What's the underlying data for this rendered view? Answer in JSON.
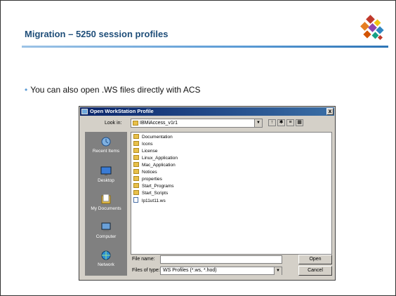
{
  "slide": {
    "title": "Migration – 5250 session profiles",
    "bullet": "You can also open .WS files directly with ACS"
  },
  "dialog": {
    "title": "Open WorkStation Profile",
    "close_label": "x",
    "look_in_label": "Look in:",
    "look_in_value": "IBMiAccess_v1r1",
    "places": [
      {
        "label": "Recent Items",
        "icon": "recent-items-icon"
      },
      {
        "label": "Desktop",
        "icon": "desktop-icon"
      },
      {
        "label": "My Documents",
        "icon": "my-documents-icon"
      },
      {
        "label": "Computer",
        "icon": "computer-icon"
      },
      {
        "label": "Network",
        "icon": "network-icon"
      }
    ],
    "files": [
      {
        "name": "Documentation",
        "type": "folder"
      },
      {
        "name": "Icons",
        "type": "folder"
      },
      {
        "name": "License",
        "type": "folder"
      },
      {
        "name": "Linux_Application",
        "type": "folder"
      },
      {
        "name": "Mac_Application",
        "type": "folder"
      },
      {
        "name": "Notices",
        "type": "folder"
      },
      {
        "name": "properties",
        "type": "folder"
      },
      {
        "name": "Start_Programs",
        "type": "folder"
      },
      {
        "name": "Start_Scripts",
        "type": "folder"
      },
      {
        "name": "lp11ut11.ws",
        "type": "file"
      }
    ],
    "file_name_label": "File name:",
    "file_name_value": "",
    "files_of_type_label": "Files of type:",
    "files_of_type_value": "WS Profiles (*.ws, *.hod)",
    "open_label": "Open",
    "cancel_label": "Cancel"
  },
  "colors": {
    "title": "#1f4e79",
    "accent": "#5b9bd5"
  }
}
